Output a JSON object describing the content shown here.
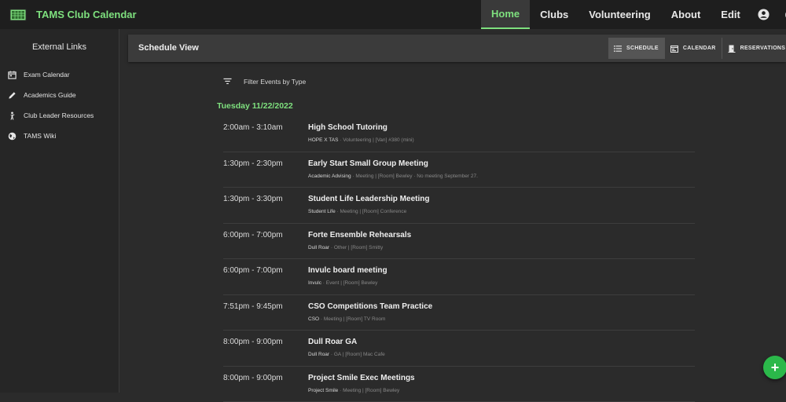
{
  "app": {
    "title": "TAMS Club Calendar"
  },
  "nav": {
    "items": [
      {
        "label": "Home"
      },
      {
        "label": "Clubs"
      },
      {
        "label": "Volunteering"
      },
      {
        "label": "About"
      },
      {
        "label": "Edit"
      }
    ],
    "icons": [
      "account-icon",
      "theme-toggle-icon",
      "github-icon"
    ]
  },
  "sidebar": {
    "title": "External Links",
    "items": [
      {
        "label": "Exam Calendar",
        "icon": "calendar-icon"
      },
      {
        "label": "Academics Guide",
        "icon": "pencil-icon"
      },
      {
        "label": "Club Leader Resources",
        "icon": "person-icon"
      },
      {
        "label": "TAMS Wiki",
        "icon": "globe-icon"
      }
    ]
  },
  "main": {
    "title": "Schedule View",
    "views": [
      {
        "label": "SCHEDULE",
        "icon": "list-icon"
      },
      {
        "label": "CALENDAR",
        "icon": "calendar-icon"
      },
      {
        "label": "RESERVATIONS",
        "icon": "door-icon"
      }
    ],
    "active_view": "SCHEDULE",
    "filter_label": "Filter Events by Type",
    "date": "Tuesday 11/22/2022"
  },
  "events": [
    {
      "time": "2:00am - 3:10am",
      "name": "High School Tutoring",
      "org": "HOPE X TAS",
      "details": " · Volunteering | [Van] #380 (mini)"
    },
    {
      "time": "1:30pm - 2:30pm",
      "name": "Early Start Small Group Meeting",
      "org": "Academic Advising",
      "details": " · Meeting | [Room] Bewley · No meeting September 27."
    },
    {
      "time": "1:30pm - 3:30pm",
      "name": "Student Life Leadership Meeting",
      "org": "Student Life",
      "details": " · Meeting | [Room] Conference"
    },
    {
      "time": "6:00pm - 7:00pm",
      "name": "Forte Ensemble Rehearsals",
      "org": "Dull Roar",
      "details": " · Other | [Room] Smitty"
    },
    {
      "time": "6:00pm - 7:00pm",
      "name": "Invulc board meeting",
      "org": "Invulc",
      "details": " · Event | [Room] Bewley"
    },
    {
      "time": "7:51pm - 9:45pm",
      "name": "CSO Competitions Team Practice",
      "org": "CSO",
      "details": " · Meeting | [Room] TV Room"
    },
    {
      "time": "8:00pm - 9:00pm",
      "name": "Dull Roar GA",
      "org": "Dull Roar",
      "details": " · GA | [Room] Mac Cafe"
    },
    {
      "time": "8:00pm - 9:00pm",
      "name": "Project Smile Exec Meetings",
      "org": "Project Smile",
      "details": " · Meeting | [Room] Bewley"
    }
  ],
  "fab": {
    "label": "+"
  },
  "colors": {
    "accent": "#7ee07e",
    "fab": "#2bb84a"
  }
}
